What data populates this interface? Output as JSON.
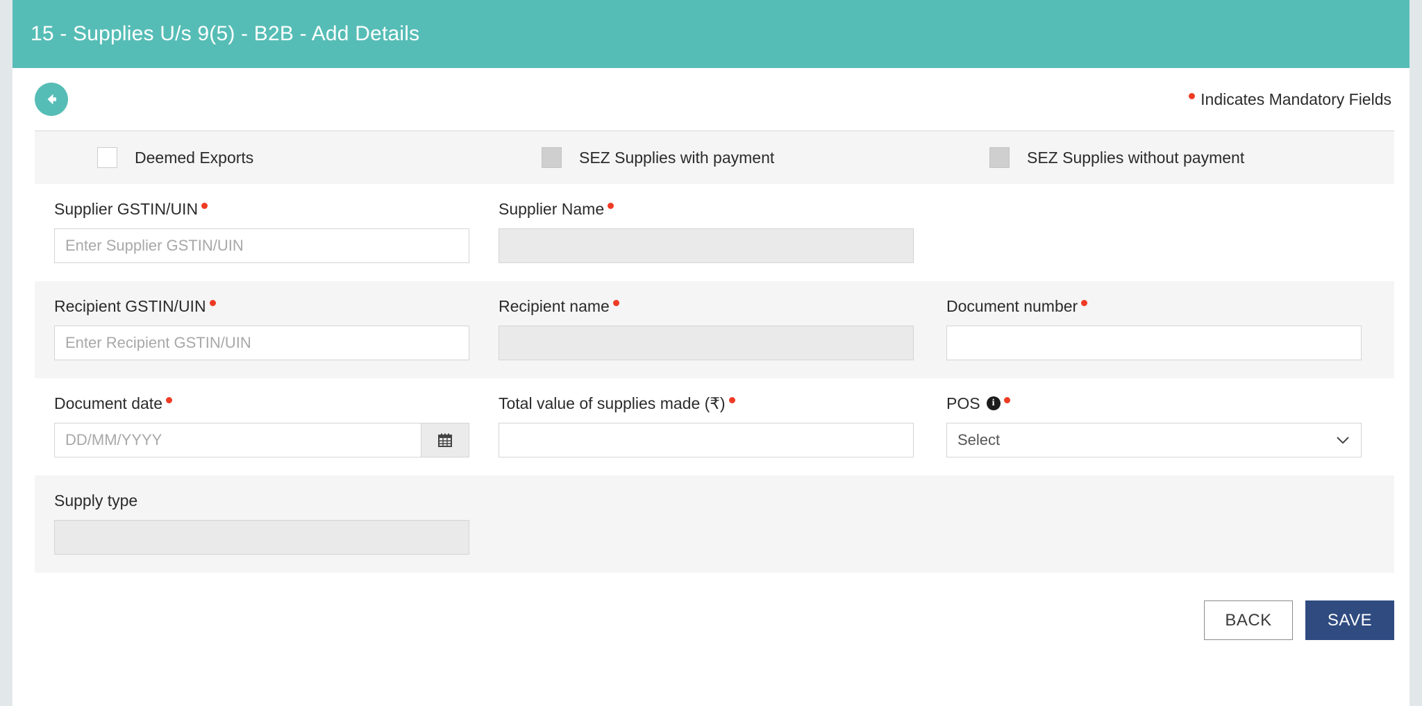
{
  "header": {
    "title": "15 - Supplies U/s 9(5) - B2B - Add Details",
    "accent_color": "#56bdb6"
  },
  "sub_header": {
    "back_icon": "arrow-left-circle-icon",
    "mandatory_note": "Indicates Mandatory Fields",
    "mandatory_dot_color": "#ef3b24"
  },
  "checkbox_row": [
    {
      "label": "Deemed Exports",
      "checked": false,
      "disabled": false
    },
    {
      "label": "SEZ Supplies with payment",
      "checked": false,
      "disabled": true
    },
    {
      "label": "SEZ Supplies without payment",
      "checked": false,
      "disabled": true
    }
  ],
  "fields": {
    "supplier_gstin": {
      "label": "Supplier GSTIN/UIN",
      "required": true,
      "placeholder": "Enter Supplier GSTIN/UIN",
      "value": ""
    },
    "supplier_name": {
      "label": "Supplier Name",
      "required": true,
      "placeholder": "",
      "value": "",
      "readonly": true
    },
    "recipient_gstin": {
      "label": "Recipient GSTIN/UIN",
      "required": true,
      "placeholder": "Enter Recipient GSTIN/UIN",
      "value": ""
    },
    "recipient_name": {
      "label": "Recipient name",
      "required": true,
      "placeholder": "",
      "value": "",
      "readonly": true
    },
    "document_number": {
      "label": "Document number",
      "required": true,
      "placeholder": "",
      "value": ""
    },
    "document_date": {
      "label": "Document date",
      "required": true,
      "placeholder": "DD/MM/YYYY",
      "value": "",
      "addon_icon": "calendar-icon"
    },
    "total_value": {
      "label": "Total value of supplies made (₹)",
      "required": true,
      "placeholder": "",
      "value": ""
    },
    "pos": {
      "label": "POS",
      "required": true,
      "info_icon": "info-icon",
      "selected": "Select"
    },
    "supply_type": {
      "label": "Supply type",
      "required": false,
      "placeholder": "",
      "value": "",
      "readonly": true
    }
  },
  "footer": {
    "back_label": "BACK",
    "save_label": "SAVE",
    "save_color": "#2f4b80"
  }
}
